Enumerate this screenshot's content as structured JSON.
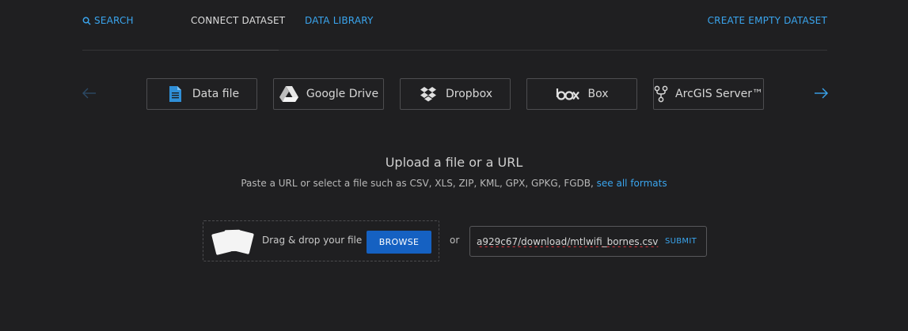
{
  "nav": {
    "search_label": "SEARCH",
    "connect_label": "CONNECT DATASET",
    "library_label": "DATA LIBRARY",
    "create_label": "CREATE EMPTY DATASET"
  },
  "providers": [
    {
      "label": "Data file",
      "icon": "file-icon"
    },
    {
      "label": "Google Drive",
      "icon": "google-drive-icon"
    },
    {
      "label": "Dropbox",
      "icon": "dropbox-icon"
    },
    {
      "label": "Box",
      "icon": "box-icon"
    },
    {
      "label": "ArcGIS Server™",
      "icon": "arcgis-icon"
    }
  ],
  "upload": {
    "title": "Upload a file or a URL",
    "subtitle": "Paste a URL or select a file such as CSV, XLS, ZIP, KML, GPX, GPKG, FGDB,",
    "formats_link": "see all formats",
    "drop_text": "Drag & drop your file",
    "browse_label": "BROWSE",
    "or_label": "or",
    "url_value": "a929c67/download/mtlwifi_bornes.csv",
    "submit_label": "SUBMIT"
  },
  "colors": {
    "accent": "#3aa5ee",
    "button": "#1561c2",
    "background": "#1f1f21",
    "file_icon": "#2f8fd8"
  }
}
